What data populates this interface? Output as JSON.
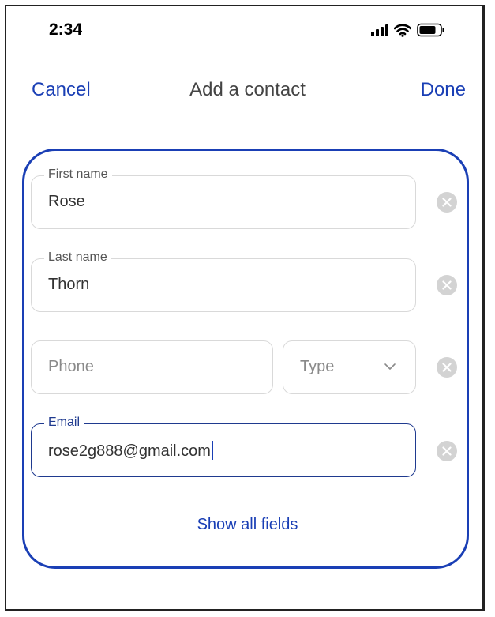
{
  "status_bar": {
    "time": "2:34"
  },
  "nav": {
    "cancel_label": "Cancel",
    "title": "Add a contact",
    "done_label": "Done"
  },
  "form": {
    "first_name": {
      "label": "First name",
      "value": "Rose"
    },
    "last_name": {
      "label": "Last name",
      "value": "Thorn"
    },
    "phone": {
      "placeholder": "Phone",
      "value": ""
    },
    "phone_type": {
      "placeholder": "Type"
    },
    "email": {
      "label": "Email",
      "value": "rose2g888@gmail.com"
    },
    "show_all_label": "Show all fields"
  },
  "colors": {
    "accent": "#1a3fb5",
    "clear_button": "#d3d3d3",
    "field_border": "#d9d9d9"
  }
}
